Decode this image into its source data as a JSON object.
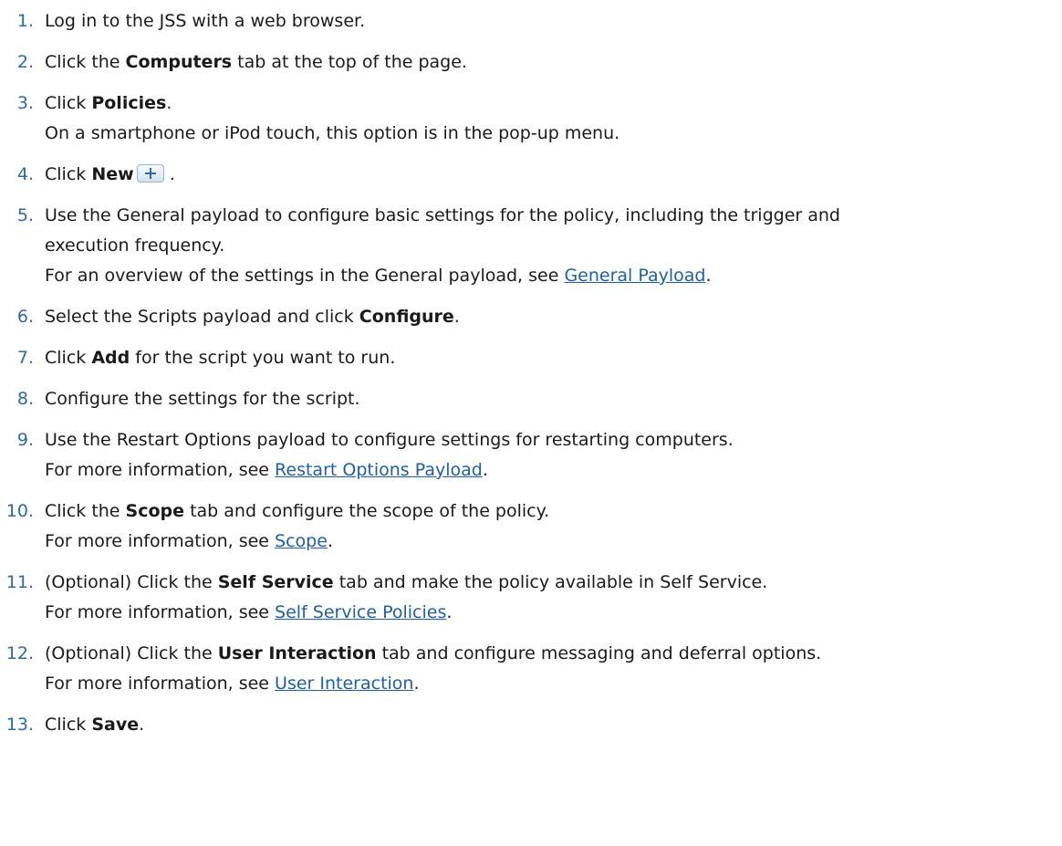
{
  "steps": [
    {
      "num": "1.",
      "text": "Log in to the JSS with a web browser."
    },
    {
      "num": "2.",
      "pre": "Click the ",
      "bold": "Computers",
      "post": " tab at the top of the page."
    },
    {
      "num": "3.",
      "pre": "Click ",
      "bold": "Policies",
      "post": ".",
      "note": "On a smartphone or iPod touch, this option is in the pop-up menu."
    },
    {
      "num": "4.",
      "pre": "Click ",
      "bold": "New",
      "post": " .",
      "icon": "plus-icon"
    },
    {
      "num": "5.",
      "line1": "Use the General payload to configure basic settings for the policy, including the trigger and",
      "line2": "execution frequency.",
      "note_pre": "For an overview of the settings in the General payload, see ",
      "link": "General Payload",
      "note_post": "."
    },
    {
      "num": "6.",
      "pre": "Select the Scripts payload and click ",
      "bold": "Configure",
      "post": "."
    },
    {
      "num": "7.",
      "pre": "Click ",
      "bold": "Add",
      "post": " for the script you want to run."
    },
    {
      "num": "8.",
      "text": "Configure the settings for the script."
    },
    {
      "num": "9.",
      "text": "Use the Restart Options payload to configure settings for restarting computers.",
      "note_pre": "For more information, see ",
      "link": "Restart Options Payload",
      "note_post": "."
    },
    {
      "num": "10.",
      "pre": "Click the ",
      "bold": "Scope",
      "post": " tab and configure the scope of the policy.",
      "note_pre": "For more information, see ",
      "link": "Scope",
      "note_post": "."
    },
    {
      "num": "11.",
      "pre": "(Optional) Click the ",
      "bold": "Self Service",
      "post": " tab and make the policy available in Self Service.",
      "note_pre": "For more information, see ",
      "link": "Self Service Policies",
      "note_post": "."
    },
    {
      "num": "12.",
      "pre": "(Optional) Click the ",
      "bold": "User Interaction",
      "post": " tab and configure messaging and deferral options.",
      "note_pre": "For more information, see ",
      "link": "User Interaction",
      "note_post": "."
    },
    {
      "num": "13.",
      "pre": "Click ",
      "bold": "Save",
      "post": "."
    }
  ],
  "colors": {
    "number": "#2d6aa6",
    "link": "#1f5fa8",
    "text": "#1a1a1a"
  }
}
